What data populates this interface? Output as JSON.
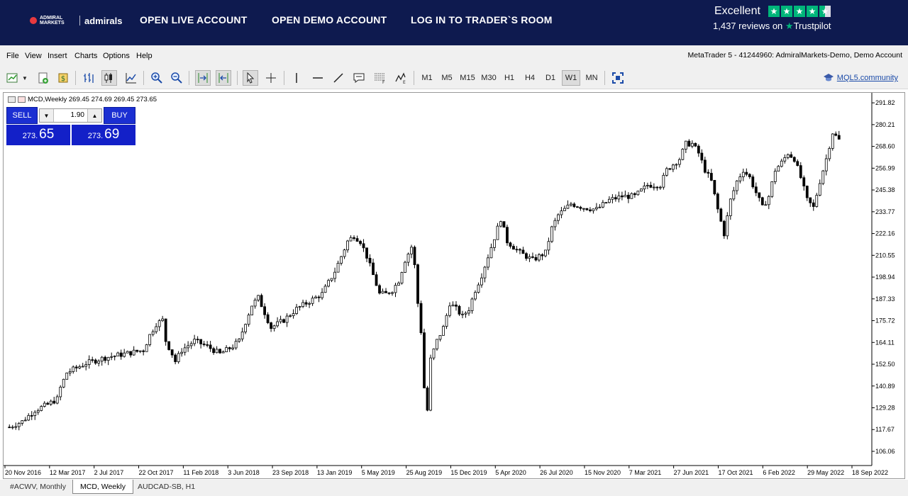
{
  "topbar": {
    "logo_small": "ADMIRAL MARKETS",
    "logo_word": "admirals",
    "links": [
      "OPEN LIVE ACCOUNT",
      "OPEN DEMO ACCOUNT",
      "LOG IN TO TRADER`S ROOM"
    ],
    "trustpilot": {
      "rating_text": "Excellent",
      "reviews_text": "1,437 reviews on",
      "brand": "Trustpilot",
      "stars": 4.5
    }
  },
  "menubar": {
    "items": [
      "File",
      "View",
      "Insert",
      "Charts",
      "Options",
      "Help"
    ],
    "title": "MetaTrader 5 - 41244960: AdmiralMarkets-Demo, Demo Account"
  },
  "toolbar": {
    "timeframes": [
      "M1",
      "M5",
      "M15",
      "M30",
      "H1",
      "H4",
      "D1",
      "W1",
      "MN"
    ],
    "active_timeframe": "W1",
    "community_link": "MQL5.community"
  },
  "chart": {
    "symbol_line": "MCD,Weekly  269.45 274.69 269.45 273.65",
    "one_click": {
      "sell_label": "SELL",
      "buy_label": "BUY",
      "volume": "1.90",
      "sell_price_small": "273.",
      "sell_price_big": "65",
      "buy_price_small": "273.",
      "buy_price_big": "69"
    }
  },
  "chart_data": {
    "type": "candlestick",
    "symbol": "MCD",
    "timeframe": "Weekly",
    "ylim": [
      98.5,
      296.4
    ],
    "y_ticks": [
      "291.82",
      "280.21",
      "268.60",
      "256.99",
      "245.38",
      "233.77",
      "222.16",
      "210.55",
      "198.94",
      "187.33",
      "175.72",
      "164.11",
      "152.50",
      "140.89",
      "129.28",
      "117.67",
      "106.06"
    ],
    "x_ticks": [
      "20 Nov 2016",
      "12 Mar 2017",
      "2 Jul 2017",
      "22 Oct 2017",
      "11 Feb 2018",
      "3 Jun 2018",
      "23 Sep 2018",
      "13 Jan 2019",
      "5 May 2019",
      "25 Aug 2019",
      "15 Dec 2019",
      "5 Apr 2020",
      "26 Jul 2020",
      "15 Nov 2020",
      "7 Mar 2021",
      "27 Jun 2021",
      "17 Oct 2021",
      "6 Feb 2022",
      "29 May 2022",
      "18 Sep 2022"
    ],
    "close_path": [
      [
        0,
        119
      ],
      [
        4,
        122
      ],
      [
        8,
        128
      ],
      [
        12,
        131
      ],
      [
        15,
        134
      ],
      [
        16,
        140
      ],
      [
        18,
        148
      ],
      [
        24,
        153
      ],
      [
        30,
        156
      ],
      [
        36,
        158
      ],
      [
        42,
        160
      ],
      [
        44,
        168
      ],
      [
        46,
        174
      ],
      [
        48,
        176
      ],
      [
        49,
        165
      ],
      [
        51,
        158
      ],
      [
        52,
        154
      ],
      [
        54,
        160
      ],
      [
        58,
        165
      ],
      [
        62,
        162
      ],
      [
        64,
        160
      ],
      [
        66,
        158
      ],
      [
        70,
        162
      ],
      [
        72,
        165
      ],
      [
        74,
        175
      ],
      [
        76,
        184
      ],
      [
        78,
        188
      ],
      [
        80,
        180
      ],
      [
        82,
        172
      ],
      [
        86,
        176
      ],
      [
        90,
        182
      ],
      [
        94,
        186
      ],
      [
        98,
        190
      ],
      [
        100,
        196
      ],
      [
        102,
        202
      ],
      [
        104,
        210
      ],
      [
        106,
        218
      ],
      [
        108,
        221
      ],
      [
        110,
        218
      ],
      [
        112,
        210
      ],
      [
        114,
        200
      ],
      [
        116,
        190
      ],
      [
        118,
        190
      ],
      [
        120,
        192
      ],
      [
        122,
        197
      ],
      [
        124,
        208
      ],
      [
        126,
        215
      ],
      [
        127,
        205
      ],
      [
        128,
        185
      ],
      [
        129,
        170
      ],
      [
        130,
        140
      ],
      [
        131,
        128
      ],
      [
        132,
        155
      ],
      [
        134,
        165
      ],
      [
        136,
        172
      ],
      [
        138,
        185
      ],
      [
        140,
        182
      ],
      [
        142,
        178
      ],
      [
        144,
        182
      ],
      [
        146,
        192
      ],
      [
        148,
        200
      ],
      [
        150,
        210
      ],
      [
        152,
        220
      ],
      [
        154,
        230
      ],
      [
        156,
        218
      ],
      [
        158,
        215
      ],
      [
        160,
        212
      ],
      [
        162,
        210
      ],
      [
        164,
        208
      ],
      [
        166,
        210
      ],
      [
        168,
        212
      ],
      [
        170,
        225
      ],
      [
        172,
        232
      ],
      [
        176,
        238
      ],
      [
        180,
        236
      ],
      [
        184,
        235
      ],
      [
        188,
        240
      ],
      [
        192,
        242
      ],
      [
        196,
        242
      ],
      [
        200,
        248
      ],
      [
        204,
        248
      ],
      [
        206,
        256
      ],
      [
        210,
        262
      ],
      [
        212,
        270
      ],
      [
        214,
        270
      ],
      [
        216,
        265
      ],
      [
        218,
        256
      ],
      [
        220,
        250
      ],
      [
        222,
        235
      ],
      [
        224,
        222
      ],
      [
        226,
        240
      ],
      [
        228,
        250
      ],
      [
        230,
        256
      ],
      [
        232,
        252
      ],
      [
        234,
        244
      ],
      [
        236,
        236
      ],
      [
        238,
        242
      ],
      [
        240,
        256
      ],
      [
        242,
        260
      ],
      [
        244,
        265
      ],
      [
        246,
        262
      ],
      [
        248,
        252
      ],
      [
        250,
        240
      ],
      [
        252,
        236
      ],
      [
        254,
        250
      ],
      [
        256,
        262
      ],
      [
        258,
        276
      ],
      [
        260,
        272
      ]
    ]
  },
  "tabs": [
    {
      "label": "#ACWV, Monthly",
      "active": false
    },
    {
      "label": "MCD, Weekly",
      "active": true
    },
    {
      "label": "AUDCAD-SB, H1",
      "active": false
    }
  ]
}
